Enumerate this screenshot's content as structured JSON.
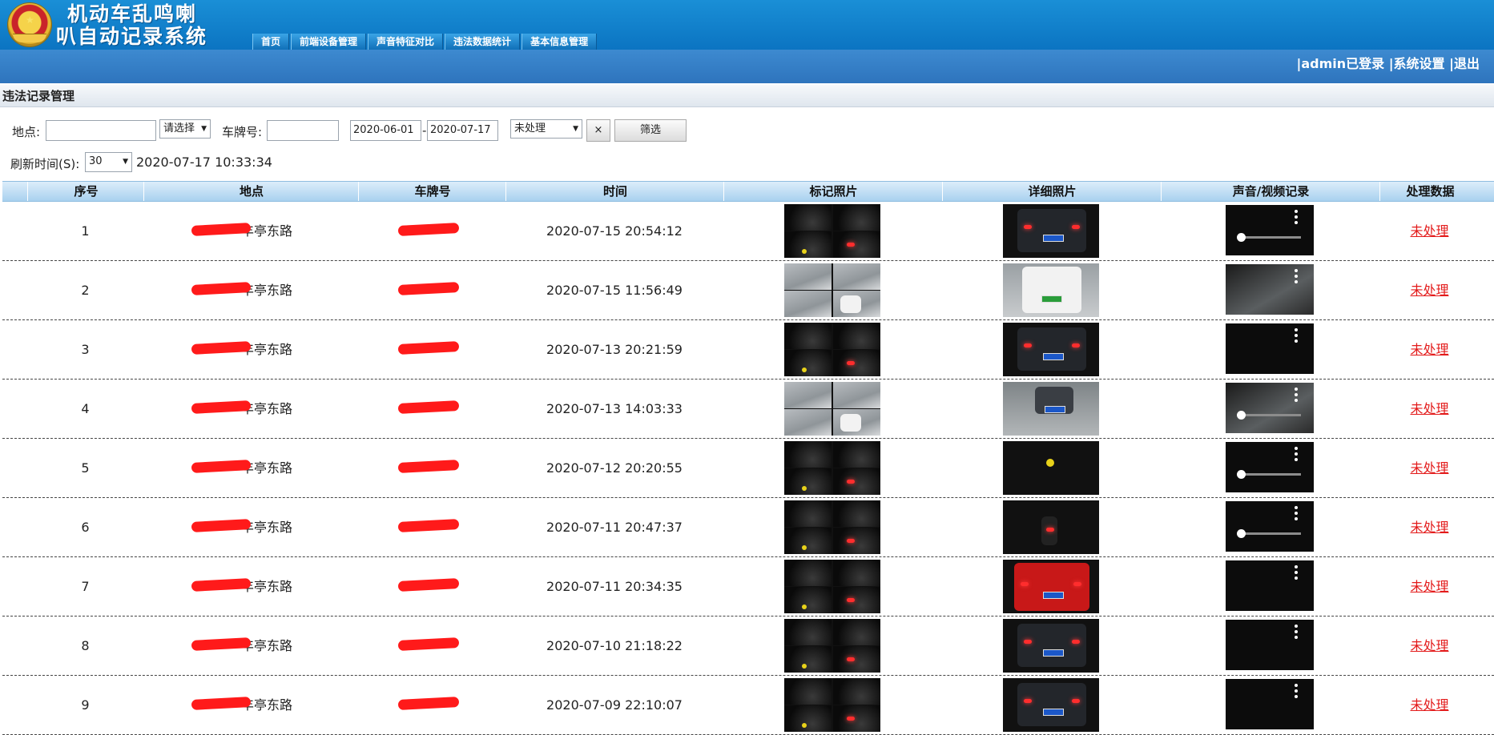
{
  "header": {
    "title_line1": "机动车乱鸣喇",
    "title_line2": "叭自动记录系统",
    "nav": [
      "首页",
      "前端设备管理",
      "声音特征对比",
      "违法数据统计",
      "基本信息管理"
    ]
  },
  "userbar": {
    "login": "|admin已登录",
    "settings": "|系统设置",
    "logout": "|退出"
  },
  "section_title": "违法记录管理",
  "filters": {
    "location_label": "地点:",
    "location_value": "",
    "location_select": "请选择",
    "plate_label": "车牌号:",
    "plate_value": "",
    "date_from": "2020-06-01",
    "date_sep": "-",
    "date_to": "2020-07-17",
    "status_select": "未处理",
    "clear_button": "×",
    "filter_button": "筛选"
  },
  "refresh": {
    "label": "刷新时间(S):",
    "interval": "30",
    "timestamp": "2020-07-17 10:33:34"
  },
  "table": {
    "headers": [
      "序号",
      "地点",
      "车牌号",
      "时间",
      "标记照片",
      "详细照片",
      "声音/视频记录",
      "处理数据"
    ],
    "rows": [
      {
        "no": "1",
        "location": "丰亭东路",
        "plate": "",
        "time": "2020-07-15 20:54:12",
        "status": "未处理"
      },
      {
        "no": "2",
        "location": "丰亭东路",
        "plate": "",
        "time": "2020-07-15 11:56:49",
        "status": "未处理"
      },
      {
        "no": "3",
        "location": "丰亭东路",
        "plate": "",
        "time": "2020-07-13 20:21:59",
        "status": "未处理"
      },
      {
        "no": "4",
        "location": "丰亭东路",
        "plate": "",
        "time": "2020-07-13 14:03:33",
        "status": "未处理"
      },
      {
        "no": "5",
        "location": "丰亭东路",
        "plate": "",
        "time": "2020-07-12 20:20:55",
        "status": "未处理"
      },
      {
        "no": "6",
        "location": "丰亭东路",
        "plate": "",
        "time": "2020-07-11 20:47:37",
        "status": "未处理"
      },
      {
        "no": "7",
        "location": "丰亭东路",
        "plate": "",
        "time": "2020-07-11 20:34:35",
        "status": "未处理"
      },
      {
        "no": "8",
        "location": "丰亭东路",
        "plate": "",
        "time": "2020-07-10 21:18:22",
        "status": "未处理"
      },
      {
        "no": "9",
        "location": "丰亭东路",
        "plate": "",
        "time": "2020-07-09 22:10:07",
        "status": "未处理"
      }
    ]
  }
}
